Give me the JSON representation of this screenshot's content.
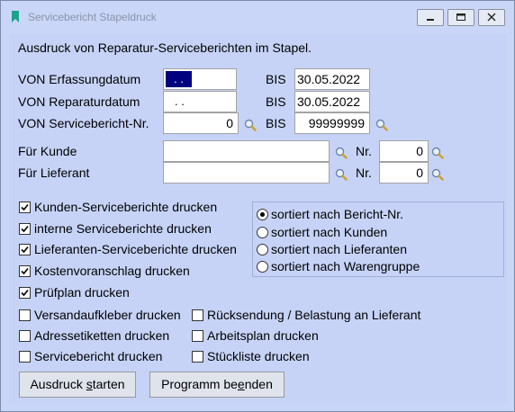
{
  "window": {
    "title": "Servicebericht Stapeldruck",
    "buttons": [
      "minimize",
      "restore",
      "close"
    ]
  },
  "header": {
    "description": "Ausdruck von Reparatur-Serviceberichten im Stapel."
  },
  "fields": {
    "erfassung_label": "VON Erfassungdatum",
    "erfassung_von": " .  . ",
    "erfassung_bis_label": "BIS",
    "erfassung_bis": "30.05.2022",
    "reparatur_label": "VON Reparaturdatum",
    "reparatur_von": " .  . ",
    "reparatur_bis_label": "BIS",
    "reparatur_bis": "30.05.2022",
    "bericht_label": "VON Servicebericht-Nr.",
    "bericht_von": "0",
    "bericht_bis_label": "BIS",
    "bericht_bis": "99999999",
    "kunde_label": "Für Kunde",
    "kunde_value": "",
    "kunde_nr_label": "Nr.",
    "kunde_nr": "0",
    "lieferant_label": "Für Lieferant",
    "lieferant_value": "",
    "lieferant_nr_label": "Nr.",
    "lieferant_nr": "0"
  },
  "checkboxes": [
    {
      "label": "Kunden-Serviceberichte drucken",
      "checked": true
    },
    {
      "label": "interne Serviceberichte drucken",
      "checked": true
    },
    {
      "label": "Lieferanten-Serviceberichte drucken",
      "checked": true
    },
    {
      "label": "Kostenvoranschlag drucken",
      "checked": true
    },
    {
      "label": "Prüfplan drucken",
      "checked": true
    },
    {
      "label": "Versandaufkleber drucken",
      "checked": false
    },
    {
      "label": "Adressetiketten drucken",
      "checked": false
    },
    {
      "label": "Servicebericht drucken",
      "checked": false
    },
    {
      "label": "Rücksendung / Belastung an Lieferant",
      "checked": false
    },
    {
      "label": "Arbeitsplan drucken",
      "checked": false
    },
    {
      "label": "Stückliste drucken",
      "checked": false
    }
  ],
  "sort_options": [
    {
      "label": "sortiert nach Bericht-Nr.",
      "selected": true
    },
    {
      "label": "sortiert nach Kunden",
      "selected": false
    },
    {
      "label": "sortiert nach Lieferanten",
      "selected": false
    },
    {
      "label": "sortiert nach Warengruppe",
      "selected": false
    }
  ],
  "actions": {
    "start_pre": "Ausdruck ",
    "start_u": "s",
    "start_post": "tarten",
    "end_pre": "Programm be",
    "end_u": "e",
    "end_post": "nden"
  },
  "colors": {
    "background": "#c6d3f7",
    "selection": "#000080"
  },
  "icons": [
    "bookmark-icon",
    "magnifier-icon",
    "minimize-icon",
    "restore-icon",
    "close-icon"
  ]
}
